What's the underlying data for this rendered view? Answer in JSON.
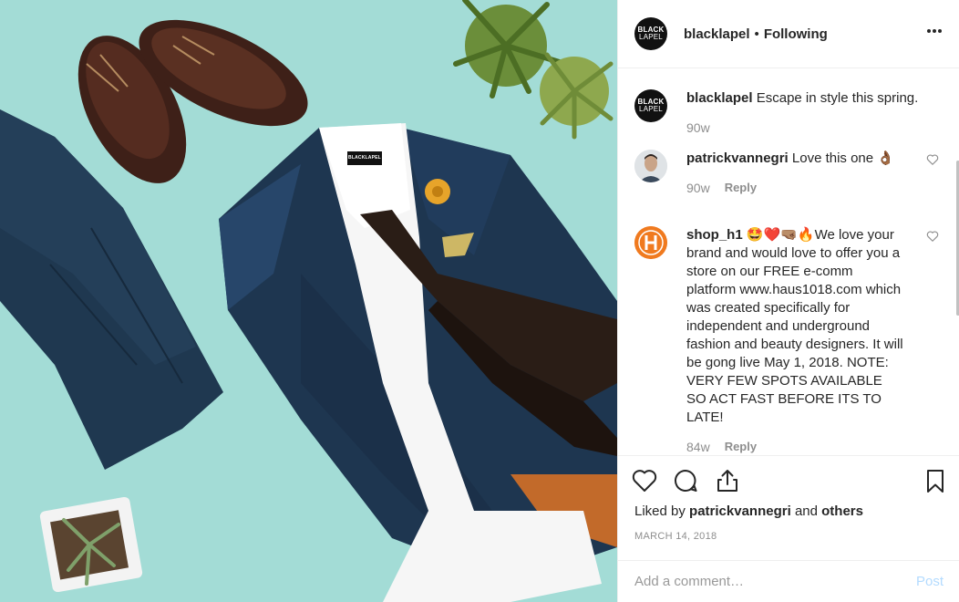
{
  "header": {
    "avatar_line1": "BLACK",
    "avatar_line2": "LAPEL",
    "username": "blacklapel",
    "separator": "•",
    "follow_status": "Following",
    "more_icon": "more-horizontal-icon"
  },
  "photo": {
    "tag_text": "BLACKLAPEL",
    "colors": {
      "background": "#a3dcd6",
      "suit": "#1e3650",
      "tie": "#2a1d16",
      "shoes": "#3e2018",
      "lining": "#c26a2a"
    }
  },
  "caption": {
    "username": "blacklapel",
    "text": "Escape in style this spring.",
    "time": "90w"
  },
  "comments": [
    {
      "username": "patrickvannegri",
      "text": "Love this one 👌🏾",
      "time": "90w",
      "reply": "Reply"
    },
    {
      "username": "shop_h1",
      "text": "🤩❤️🤜🏽🔥We love your brand and would love to offer you a store on our FREE e-comm platform www.haus1018.com which was created specifically for independent and underground fashion and beauty designers. It will be gong live May 1, 2018. NOTE: VERY FEW SPOTS AVAILABLE SO ACT FAST BEFORE ITS TO LATE!",
      "time": "84w",
      "reply": "Reply"
    }
  ],
  "actions": {
    "liked_prefix": "Liked by",
    "liked_user": "patrickvannegri",
    "liked_and": "and",
    "liked_others": "others",
    "date": "MARCH 14, 2018"
  },
  "add_comment": {
    "placeholder": "Add a comment…",
    "post_label": "Post"
  }
}
